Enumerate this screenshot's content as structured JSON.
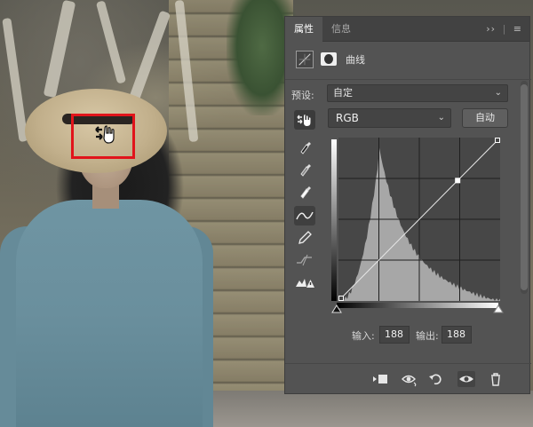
{
  "panel": {
    "tabs": [
      {
        "label": "属性",
        "active": true
      },
      {
        "label": "信息",
        "active": false
      }
    ],
    "header_icons": {
      "collapse": "››",
      "menu": "≡"
    },
    "title": "曲线",
    "preset": {
      "label": "预设:",
      "value": "自定"
    },
    "channel": {
      "value": "RGB"
    },
    "auto_label": "自动",
    "input": {
      "label": "输入:",
      "value": "188"
    },
    "output": {
      "label": "输出:",
      "value": "188"
    },
    "tools": [
      {
        "name": "on-image-adjust",
        "icon": "hand-arrows-icon"
      },
      {
        "name": "black-eyedropper",
        "icon": "eyedropper-icon"
      },
      {
        "name": "gray-eyedropper",
        "icon": "eyedropper-icon"
      },
      {
        "name": "white-eyedropper",
        "icon": "eyedropper-icon"
      },
      {
        "name": "curve-edit",
        "icon": "curve-icon"
      },
      {
        "name": "pencil-draw",
        "icon": "pencil-icon"
      },
      {
        "name": "smooth",
        "icon": "smooth-curve-icon"
      },
      {
        "name": "clipping-warning",
        "icon": "clipping-warning-icon"
      }
    ],
    "bottom_icons": [
      "clip-to-layer-icon",
      "view-previous-state-icon",
      "reset-icon",
      "visibility-eye-icon",
      "trash-icon"
    ]
  },
  "curve": {
    "input_range": [
      0,
      255
    ],
    "output_range": [
      0,
      255
    ],
    "points": [
      [
        0,
        0
      ],
      [
        188,
        188
      ],
      [
        255,
        255
      ]
    ],
    "histogram_peak_input": 64
  },
  "colors": {
    "highlight": "#e1141b",
    "panel_bg": "#535353",
    "panel_header": "#424242"
  }
}
